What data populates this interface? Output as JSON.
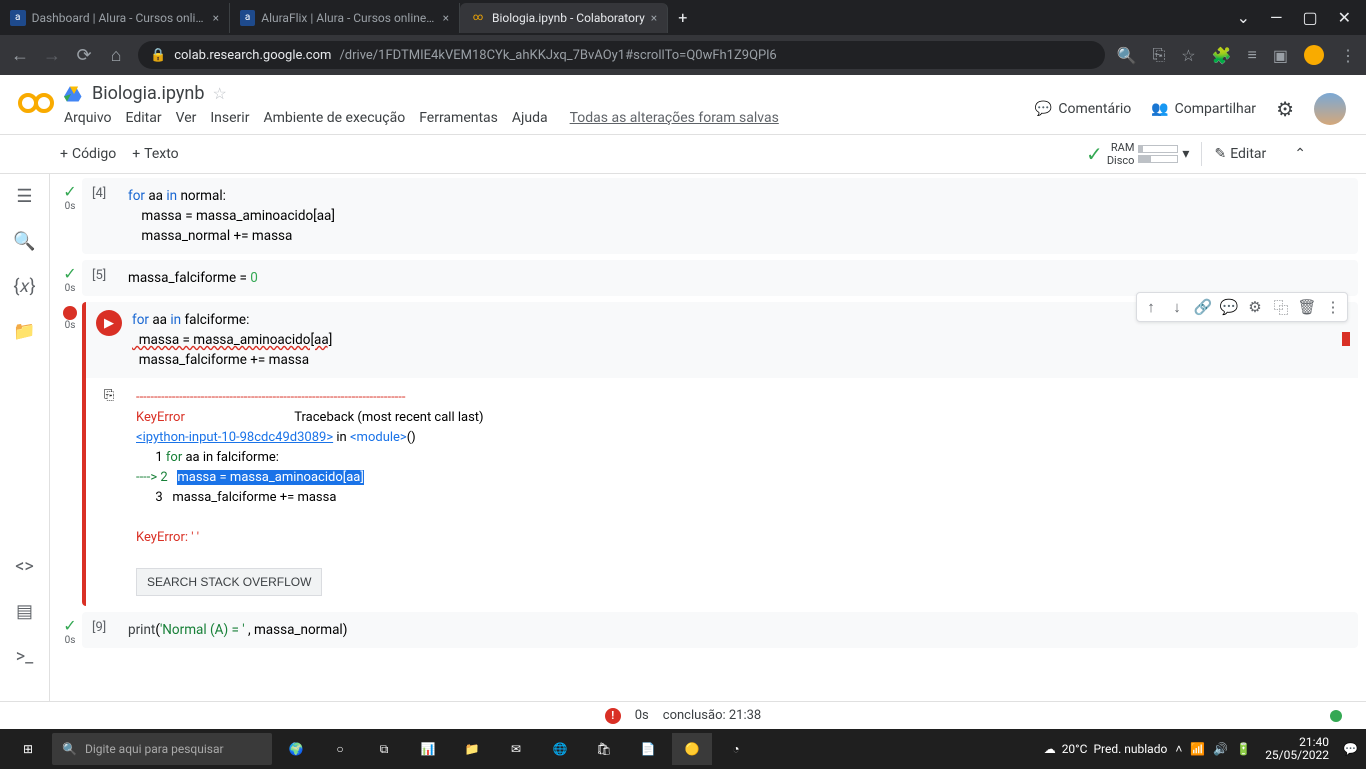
{
  "browser": {
    "tabs": [
      {
        "title": "Dashboard | Alura - Cursos onlin...",
        "icon": "a"
      },
      {
        "title": "AluraFlix | Alura - Cursos online d...",
        "icon": "a"
      },
      {
        "title": "Biologia.ipynb - Colaboratory",
        "icon": "∞",
        "active": true
      }
    ],
    "url_domain": "colab.research.google.com",
    "url_path": "/drive/1FDTMIE4kVEM18CYk_ahKKJxq_7BvAOy1#scrollTo=Q0wFh1Z9QPl6"
  },
  "colab": {
    "notebook_name": "Biologia.ipynb",
    "menu": [
      "Arquivo",
      "Editar",
      "Ver",
      "Inserir",
      "Ambiente de execução",
      "Ferramentas",
      "Ajuda"
    ],
    "save_status": "Todas as alterações foram salvas",
    "actions": {
      "comment": "Comentário",
      "share": "Compartilhar"
    },
    "toolbar": {
      "code": "Código",
      "text": "Texto",
      "edit": "Editar"
    },
    "resources": {
      "ram": "RAM",
      "disk": "Disco"
    }
  },
  "cells": {
    "c4": {
      "exec": "[4]",
      "time": "0s",
      "l1_kw1": "for",
      "l1_v1": " aa ",
      "l1_kw2": "in",
      "l1_v2": " normal:",
      "l2": "    massa = massa_aminoacido[aa]",
      "l3": "    massa_normal += massa"
    },
    "c5": {
      "exec": "[5]",
      "time": "0s",
      "l1_a": "massa_falciforme = ",
      "l1_n": "0"
    },
    "c_err": {
      "time": "0s",
      "l1_kw1": "for",
      "l1_v1": " aa ",
      "l1_kw2": "in",
      "l1_v2": " falciforme:",
      "l2": "  massa = massa_aminoacido[aa]",
      "l3": "  massa_falciforme += massa"
    },
    "output": {
      "dashes": "---------------------------------------------------------------------------",
      "err_name": "KeyError",
      "traceback": "                                  Traceback (most recent call last)",
      "link": "<ipython-input-10-98cdc49d3089>",
      "in_text": " in ",
      "module": "<module>",
      "parens": "()",
      "line1_num": "      1 ",
      "line1_kw": "for",
      "line1_rest": " aa in falciforme:",
      "arrow": "----> 2   ",
      "line2_hl": "massa = massa_aminoacido[aa]",
      "line3": "      3   massa_falciforme += massa",
      "err_final": "KeyError: ' '",
      "so_button": "SEARCH STACK OVERFLOW"
    },
    "c9": {
      "exec": "[9]",
      "time": "0s",
      "fn": "print",
      "open": "(",
      "str": "'Normal (A) = '",
      "rest": " , massa_normal)"
    }
  },
  "status": {
    "time": "0s",
    "conclusion": "conclusão: 21:38"
  },
  "taskbar": {
    "search_placeholder": "Digite aqui para pesquisar",
    "weather_temp": "20°C",
    "weather_cond": "Pred. nublado",
    "clock_time": "21:40",
    "clock_date": "25/05/2022"
  }
}
